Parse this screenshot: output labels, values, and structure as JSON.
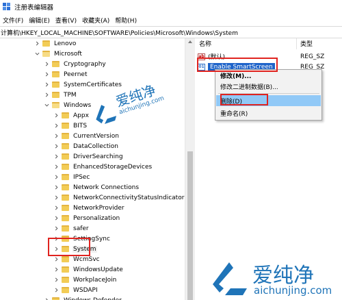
{
  "window": {
    "title": "注册表编辑器"
  },
  "menu": [
    "文件(F)",
    "编辑(E)",
    "查看(V)",
    "收藏夹(A)",
    "帮助(H)"
  ],
  "address": "计算机\\HKEY_LOCAL_MACHINE\\SOFTWARE\\Policies\\Microsoft\\Windows\\System",
  "tree": [
    {
      "label": "Lenovo",
      "depth": 0,
      "expanded": false
    },
    {
      "label": "Microsoft",
      "depth": 0,
      "expanded": true
    },
    {
      "label": "Cryptography",
      "depth": 1,
      "expanded": false
    },
    {
      "label": "Peernet",
      "depth": 1,
      "expanded": false
    },
    {
      "label": "SystemCertificates",
      "depth": 1,
      "expanded": false
    },
    {
      "label": "TPM",
      "depth": 1,
      "expanded": false
    },
    {
      "label": "Windows",
      "depth": 1,
      "expanded": true
    },
    {
      "label": "Appx",
      "depth": 2,
      "expanded": false
    },
    {
      "label": "BITS",
      "depth": 2,
      "expanded": false
    },
    {
      "label": "CurrentVersion",
      "depth": 2,
      "expanded": false
    },
    {
      "label": "DataCollection",
      "depth": 2,
      "expanded": false
    },
    {
      "label": "DriverSearching",
      "depth": 2,
      "expanded": false
    },
    {
      "label": "EnhancedStorageDevices",
      "depth": 2,
      "expanded": false
    },
    {
      "label": "IPSec",
      "depth": 2,
      "expanded": false
    },
    {
      "label": "Network Connections",
      "depth": 2,
      "expanded": false
    },
    {
      "label": "NetworkConnectivityStatusIndicator",
      "depth": 2,
      "expanded": false
    },
    {
      "label": "NetworkProvider",
      "depth": 2,
      "expanded": false
    },
    {
      "label": "Personalization",
      "depth": 2,
      "expanded": false
    },
    {
      "label": "safer",
      "depth": 2,
      "expanded": false
    },
    {
      "label": "SettingSync",
      "depth": 2,
      "expanded": false
    },
    {
      "label": "System",
      "depth": 2,
      "expanded": false,
      "selected": true
    },
    {
      "label": "WcmSvc",
      "depth": 2,
      "expanded": false
    },
    {
      "label": "WindowsUpdate",
      "depth": 2,
      "expanded": false
    },
    {
      "label": "WorkplaceJoin",
      "depth": 2,
      "expanded": false
    },
    {
      "label": "WSDAPI",
      "depth": 2,
      "expanded": false
    },
    {
      "label": "Windows Defender",
      "depth": 1,
      "expanded": false
    }
  ],
  "list": {
    "col_name": "名称",
    "col_type": "类型",
    "rows": [
      {
        "name": "(默认)",
        "type": "REG_SZ",
        "icon": "ab"
      },
      {
        "name": "Enable SmartScreen",
        "type": "REG_SZ",
        "icon": "dw",
        "selected": true
      }
    ]
  },
  "context_menu": {
    "items": [
      {
        "label": "修改(M)...",
        "bold": true
      },
      {
        "label": "修改二进制数据(B)..."
      },
      {
        "label": "删除(D)",
        "highlighted": true
      },
      {
        "label": "重命名(R)"
      }
    ]
  },
  "watermark": {
    "brand": "爱纯净",
    "url": "aichunjing.com"
  }
}
